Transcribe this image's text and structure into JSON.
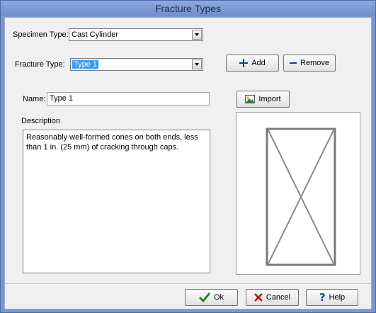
{
  "window": {
    "title": "Fracture Types"
  },
  "specimen_type": {
    "label": "Specimen Type:",
    "value": "Cast Cylinder"
  },
  "fracture_type": {
    "label": "Fracture Type:",
    "value": "Type 1"
  },
  "buttons": {
    "add": "Add",
    "remove": "Remove",
    "import": "Import",
    "ok": "Ok",
    "cancel": "Cancel",
    "help": "Help"
  },
  "name": {
    "label": "Name:",
    "value": "Type 1"
  },
  "description": {
    "label": "Description",
    "value": "Reasonably well-formed cones on both ends, less than 1 in. (25 mm) of cracking through caps."
  },
  "icons": {
    "add": "plus-icon",
    "remove": "minus-icon",
    "import": "image-icon",
    "ok": "checkmark-icon",
    "cancel": "x-icon",
    "help": "question-icon",
    "dropdown": "chevron-down-icon"
  }
}
